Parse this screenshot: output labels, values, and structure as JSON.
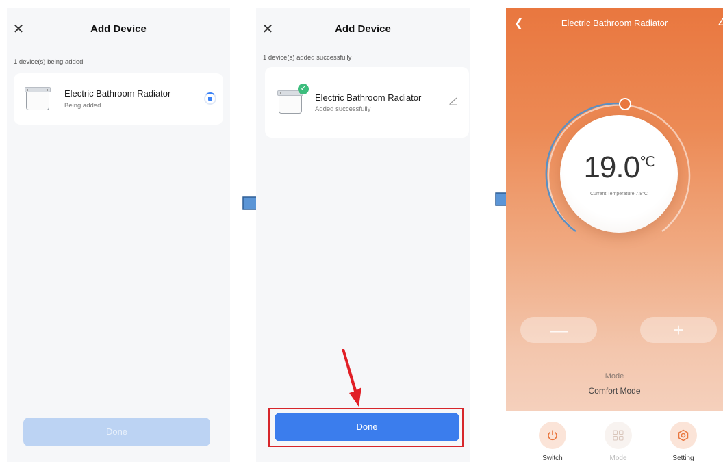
{
  "screen1": {
    "title": "Add Device",
    "status": "1 device(s) being added",
    "device": {
      "name": "Electric Bathroom Radiator",
      "status": "Being added"
    },
    "done_label": "Done"
  },
  "screen2": {
    "title": "Add Device",
    "status": "1 device(s) added successfully",
    "device": {
      "name": "Electric Bathroom Radiator",
      "status": "Added successfully"
    },
    "done_label": "Done"
  },
  "screen3": {
    "title": "Electric Bathroom Radiator",
    "temperature": "19.0",
    "temp_unit": "℃",
    "current_temp": "Current Temperature 7.8°C",
    "minus": "—",
    "plus": "+",
    "mode_label": "Mode",
    "mode_value": "Comfort Mode",
    "bottom_bar": [
      {
        "label": "Switch",
        "icon": "power-icon"
      },
      {
        "label": "Mode",
        "icon": "grid-icon"
      },
      {
        "label": "Setting",
        "icon": "gear-icon"
      }
    ]
  },
  "colors": {
    "primary_blue": "#3b7ded",
    "disabled_blue": "#bcd3f3",
    "success_green": "#3dbd7d",
    "highlight_red": "#d7262b",
    "arrow_blue": "#5b95d6",
    "orange": "#e9773f"
  }
}
